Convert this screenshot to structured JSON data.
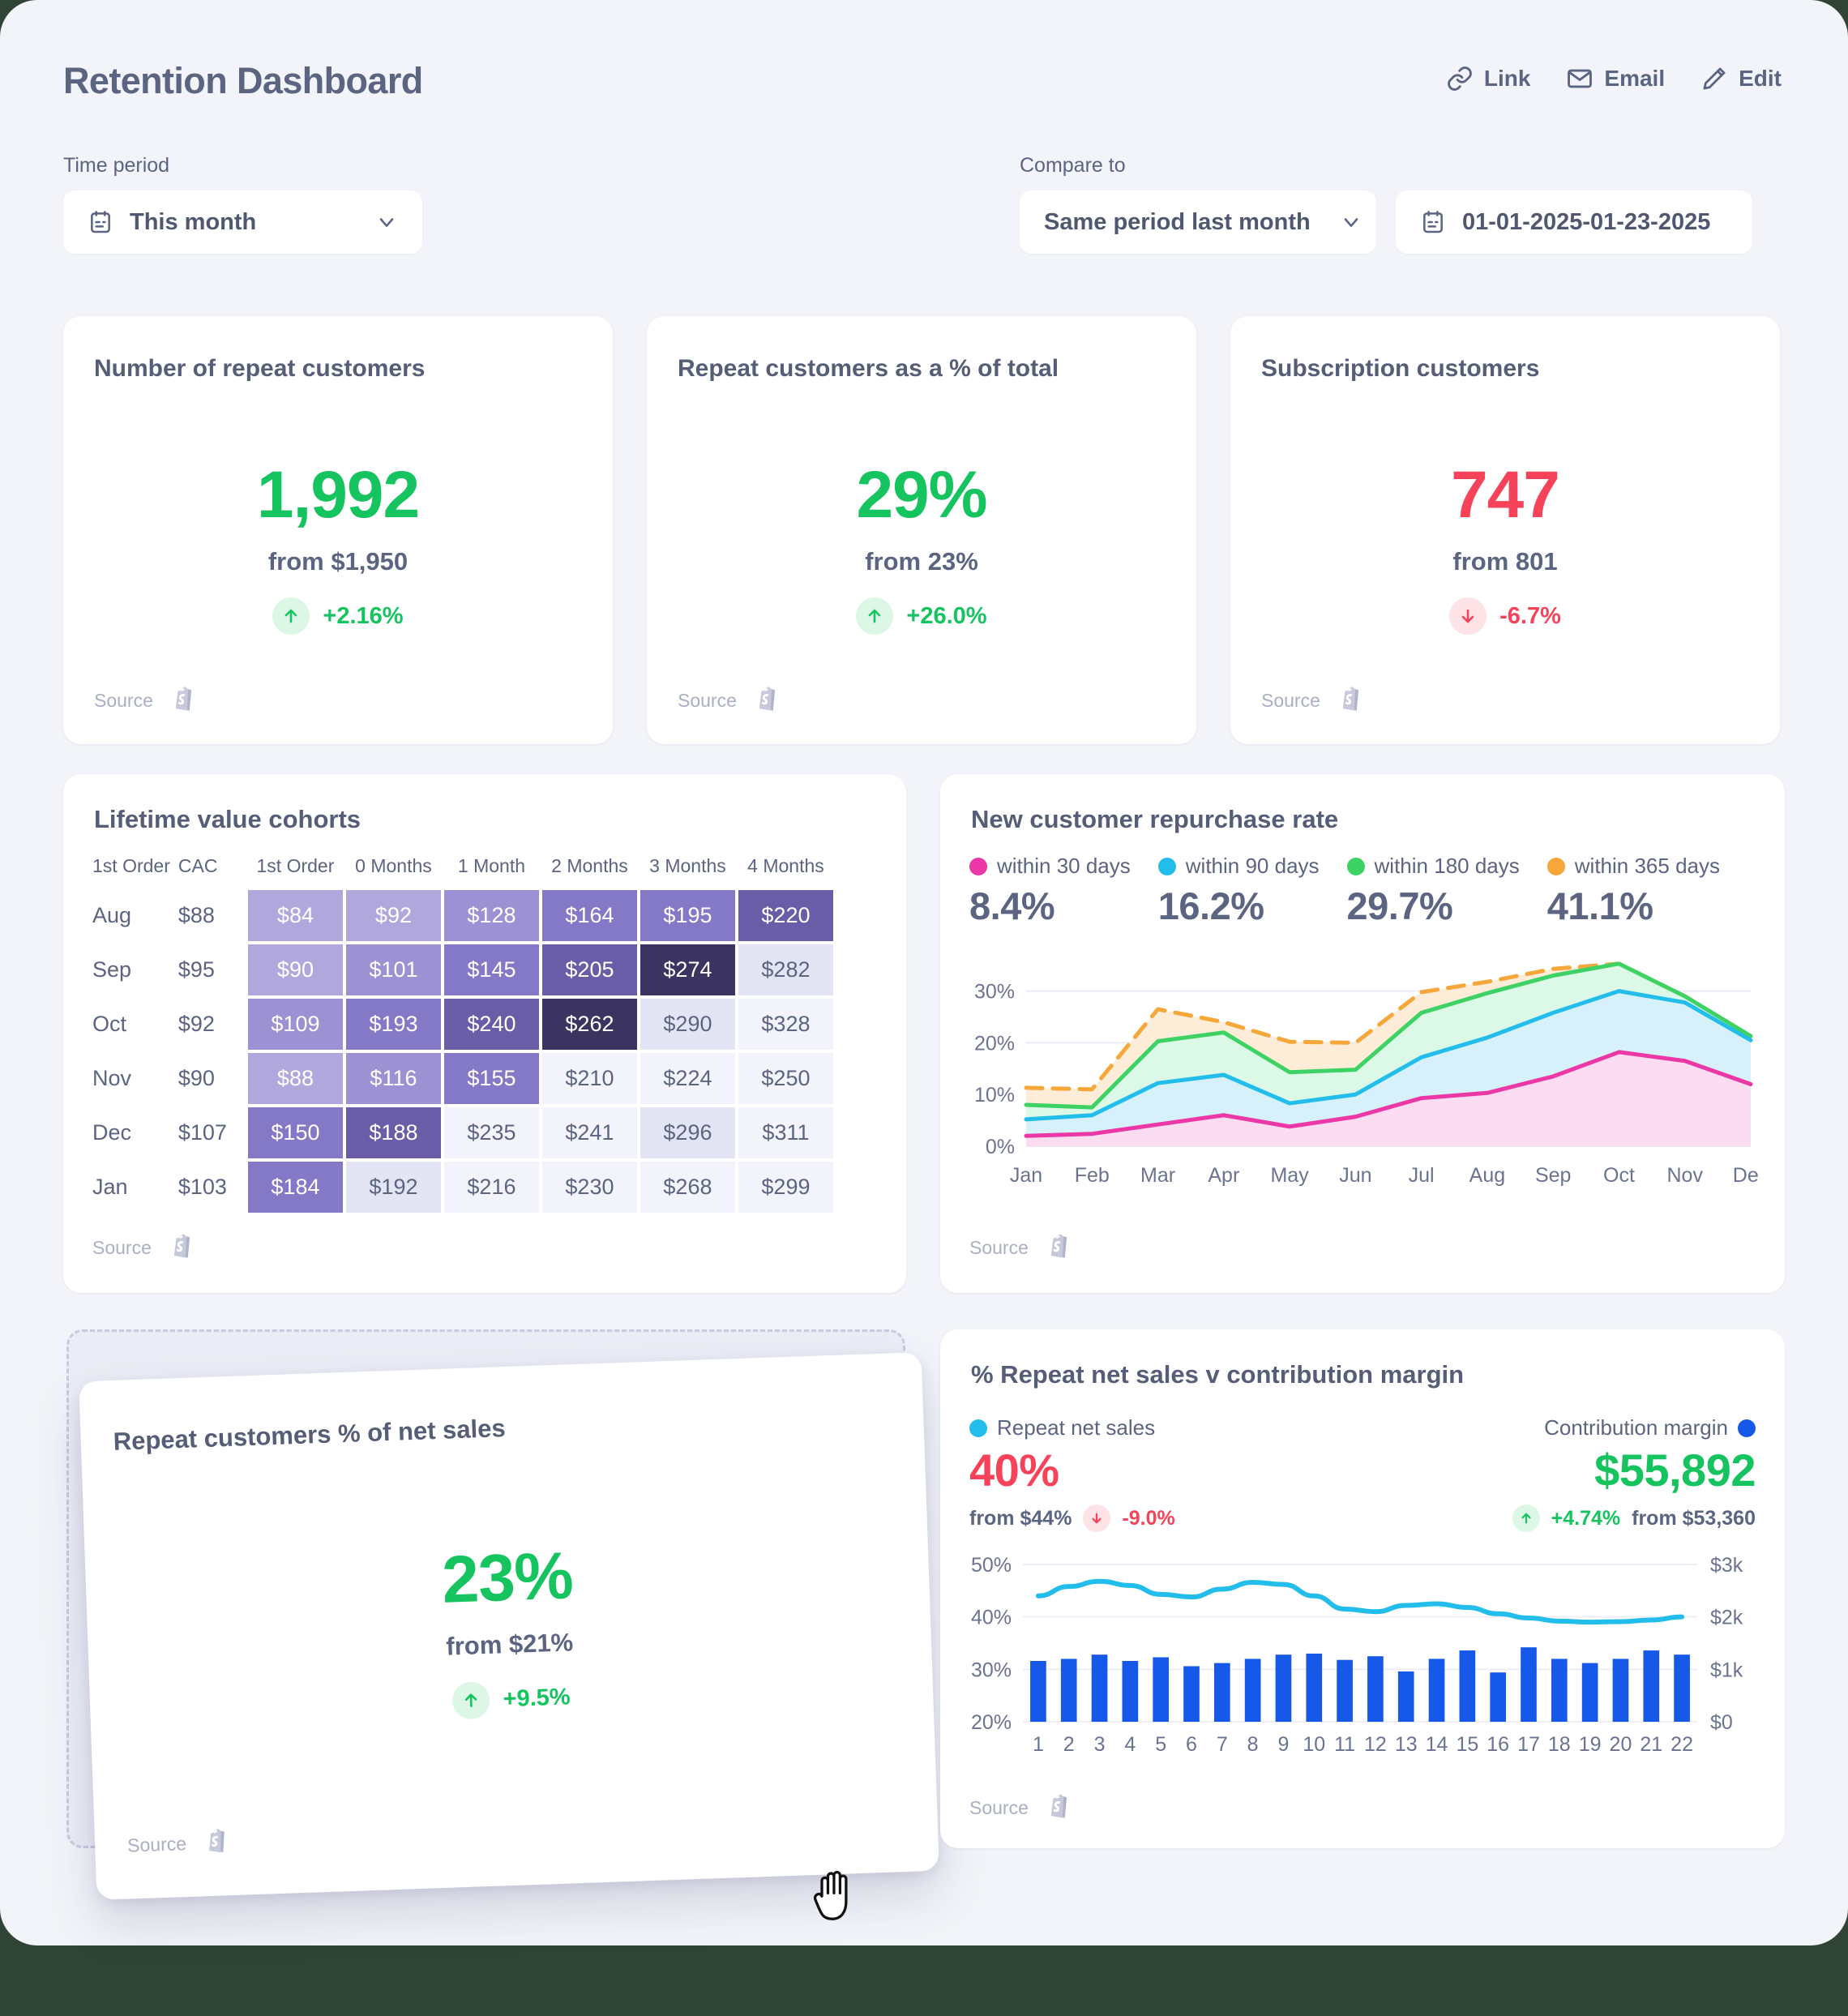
{
  "header": {
    "title": "Retention Dashboard",
    "actions": [
      {
        "label": "Link",
        "icon": "link-icon"
      },
      {
        "label": "Email",
        "icon": "email-icon"
      },
      {
        "label": "Edit",
        "icon": "pencil-icon"
      }
    ]
  },
  "filters": {
    "time_period_label": "Time period",
    "time_period_value": "This month",
    "compare_label": "Compare to",
    "compare_value": "Same period last month",
    "date_range_value": "01-01-2025-01-23-2025"
  },
  "source_label": "Source",
  "kpis": [
    {
      "title": "Number of repeat customers",
      "value": "1,992",
      "from": "from $1,950",
      "delta": "+2.16%",
      "direction": "up"
    },
    {
      "title": "Repeat customers as a % of total",
      "value": "29%",
      "from": "from 23%",
      "delta": "+26.0%",
      "direction": "up"
    },
    {
      "title": "Subscription customers",
      "value": "747",
      "from": "from 801",
      "delta": "-6.7%",
      "direction": "down"
    }
  ],
  "cohorts": {
    "title": "Lifetime value cohorts",
    "headers": [
      "1st Order",
      "CAC",
      "1st Order",
      "0 Months",
      "1 Month",
      "2 Months",
      "3 Months",
      "4 Months"
    ],
    "rows": [
      {
        "month": "Aug",
        "cac": "$88",
        "cells": [
          "$84",
          "$92",
          "$128",
          "$164",
          "$195",
          "$220"
        ]
      },
      {
        "month": "Sep",
        "cac": "$95",
        "cells": [
          "$90",
          "$101",
          "$145",
          "$205",
          "$274",
          "$282"
        ]
      },
      {
        "month": "Oct",
        "cac": "$92",
        "cells": [
          "$109",
          "$193",
          "$240",
          "$262",
          "$290",
          "$328"
        ]
      },
      {
        "month": "Nov",
        "cac": "$90",
        "cells": [
          "$88",
          "$116",
          "$155",
          "$210",
          "$224",
          "$250"
        ]
      },
      {
        "month": "Dec",
        "cac": "$107",
        "cells": [
          "$150",
          "$188",
          "$235",
          "$241",
          "$296",
          "$311"
        ]
      },
      {
        "month": "Jan",
        "cac": "$103",
        "cells": [
          "$184",
          "$192",
          "$216",
          "$230",
          "$268",
          "$299"
        ]
      }
    ],
    "cell_shades": [
      [
        4,
        4,
        5,
        6,
        6,
        7
      ],
      [
        4,
        5,
        6,
        7,
        8,
        2
      ],
      [
        5,
        6,
        7,
        8,
        2,
        1
      ],
      [
        4,
        5,
        6,
        1,
        1,
        1
      ],
      [
        6,
        7,
        1,
        1,
        2,
        1
      ],
      [
        6,
        2,
        1,
        1,
        1,
        1
      ]
    ]
  },
  "repurchase": {
    "title": "New customer repurchase rate",
    "legend": [
      {
        "name": "within 30 days",
        "value": "8.4%",
        "color": "#ec37a6"
      },
      {
        "name": "within 90 days",
        "value": "16.2%",
        "color": "#23bdeb"
      },
      {
        "name": "within 180 days",
        "value": "29.7%",
        "color": "#3ed265"
      },
      {
        "name": "within 365 days",
        "value": "41.1%",
        "color": "#f5a73a"
      }
    ]
  },
  "dragged_card": {
    "title": "Repeat customers % of net sales",
    "value": "23%",
    "from": "from $21%",
    "delta": "+9.5%",
    "direction": "up"
  },
  "margin": {
    "title": "% Repeat net sales v contribution margin",
    "left": {
      "name": "Repeat net sales",
      "color": "#23bdeb",
      "value": "40%",
      "direction": "down",
      "from": "from $44%",
      "delta": "-9.0%"
    },
    "right": {
      "name": "Contribution margin",
      "color": "#1659e8",
      "value": "$55,892",
      "direction": "up",
      "from": "from $53,360",
      "delta": "+4.74%"
    }
  },
  "chart_data": [
    {
      "type": "area",
      "title": "New customer repurchase rate",
      "xlabel": "",
      "ylabel": "",
      "ylim": [
        0,
        37
      ],
      "yticks": [
        0,
        10,
        20,
        30
      ],
      "ytick_labels": [
        "0%",
        "10%",
        "20%",
        "30%"
      ],
      "grid": true,
      "legend_position": "top",
      "x": [
        "Jan",
        "Feb",
        "Mar",
        "Apr",
        "May",
        "Jun",
        "Jul",
        "Aug",
        "Sep",
        "Oct",
        "Nov",
        "Dec"
      ],
      "series": [
        {
          "name": "within 30 days",
          "color": "#ec37a6",
          "fill": "#fcdcf0",
          "dashed": false,
          "values": [
            2.0,
            2.4,
            4.2,
            6.0,
            3.8,
            5.7,
            9.3,
            10.3,
            13.5,
            18.2,
            16.5,
            12.0
          ]
        },
        {
          "name": "within 90 days",
          "color": "#23bdeb",
          "fill": "#d7f1fb",
          "dashed": false,
          "values": [
            5.2,
            6.0,
            12.2,
            13.8,
            8.3,
            10.0,
            17.2,
            21.0,
            25.8,
            30.0,
            27.8,
            20.5
          ]
        },
        {
          "name": "within 180 days",
          "color": "#3ed265",
          "fill": "#dcf8e6",
          "dashed": false,
          "values": [
            8.0,
            7.5,
            20.3,
            22.0,
            14.3,
            14.8,
            25.8,
            29.6,
            33.0,
            35.3,
            29.0,
            21.3
          ]
        },
        {
          "name": "within 365 days",
          "color": "#f5a73a",
          "fill": "#fdecd7",
          "dashed": true,
          "values": [
            11.3,
            11.0,
            26.5,
            24.0,
            20.2,
            20.0,
            29.8,
            31.8,
            34.3,
            35.3,
            29.0,
            21.3
          ]
        }
      ]
    },
    {
      "type": "bar",
      "title": "% Repeat net sales v contribution margin",
      "categories": [
        "1",
        "2",
        "3",
        "4",
        "5",
        "6",
        "7",
        "8",
        "9",
        "10",
        "11",
        "12",
        "13",
        "14",
        "15",
        "16",
        "17",
        "18",
        "19",
        "20",
        "21",
        "22"
      ],
      "grid": true,
      "y_left": {
        "label": "",
        "ticks": [
          20,
          30,
          40,
          50
        ],
        "tick_labels": [
          "20%",
          "30%",
          "40%",
          "50%"
        ],
        "lim": [
          20,
          50
        ]
      },
      "y_right": {
        "label": "",
        "ticks": [
          0,
          1000,
          2000,
          3000
        ],
        "tick_labels": [
          "$0",
          "$1k",
          "$2k",
          "$3k"
        ],
        "lim": [
          0,
          3000
        ]
      },
      "series": [
        {
          "name": "Contribution margin",
          "type": "bar",
          "color": "#1659e8",
          "axis": "right",
          "values": [
            1160,
            1200,
            1280,
            1160,
            1230,
            1060,
            1120,
            1200,
            1280,
            1300,
            1180,
            1250,
            960,
            1200,
            1360,
            940,
            1420,
            1200,
            1120,
            1200,
            1360,
            1280
          ]
        },
        {
          "name": "Repeat net sales",
          "type": "line",
          "color": "#23bdeb",
          "axis": "left",
          "values": [
            44.0,
            45.8,
            46.8,
            46.0,
            44.3,
            43.8,
            45.3,
            46.6,
            46.2,
            44.0,
            41.5,
            41.0,
            42.2,
            42.5,
            41.8,
            40.6,
            39.8,
            39.2,
            39.0,
            39.1,
            39.4,
            40.0
          ]
        }
      ]
    }
  ]
}
